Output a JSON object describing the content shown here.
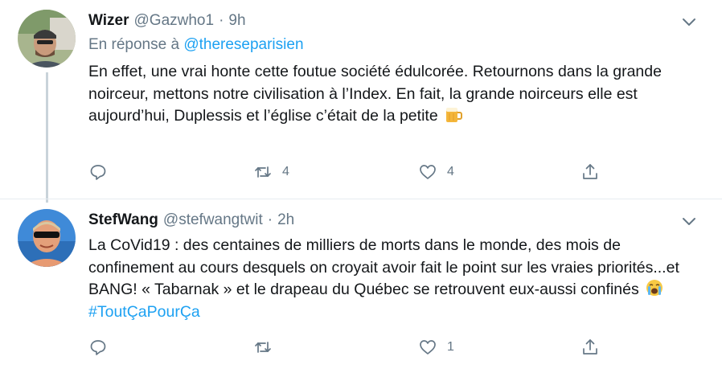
{
  "tweets": [
    {
      "display_name": "Wizer",
      "handle": "@Gazwho1",
      "separator": "·",
      "time": "9h",
      "reply_prefix": "En réponse à",
      "reply_mention": "@thereseparisien",
      "text": "En effet, une vrai honte cette foutue société édulcorée. Retournons dans la grande noirceur, mettons notre civilisation à l’Index. En fait, la grande noirceurs elle est aujourd’hui, Duplessis et l’église c’était de la petite",
      "emoji": "beer-mug-emoji",
      "retweet_count": "4",
      "like_count": "4"
    },
    {
      "display_name": "StefWang",
      "handle": "@stefwangtwit",
      "separator": "·",
      "time": "2h",
      "text": "La CoVid19 : des centaines de milliers de morts dans le monde, des mois de confinement au cours desquels on croyait avoir fait le point sur les vraies priorités...et BANG! « Tabarnak » et le drapeau du Québec se retrouvent eux-aussi confinés",
      "emoji": "crying-face-emoji",
      "hashtag": "#ToutÇaPourÇa",
      "retweet_count": "",
      "like_count": "1"
    }
  ],
  "colors": {
    "accent": "#1da1f2",
    "muted": "#657786",
    "text": "#14171a",
    "thread_line": "#c9d3da"
  },
  "icons": {
    "reply": "speech-bubble-icon",
    "retweet": "retweet-arrows-icon",
    "like": "heart-icon",
    "share": "share-upload-icon",
    "menu": "chevron-down-icon"
  }
}
